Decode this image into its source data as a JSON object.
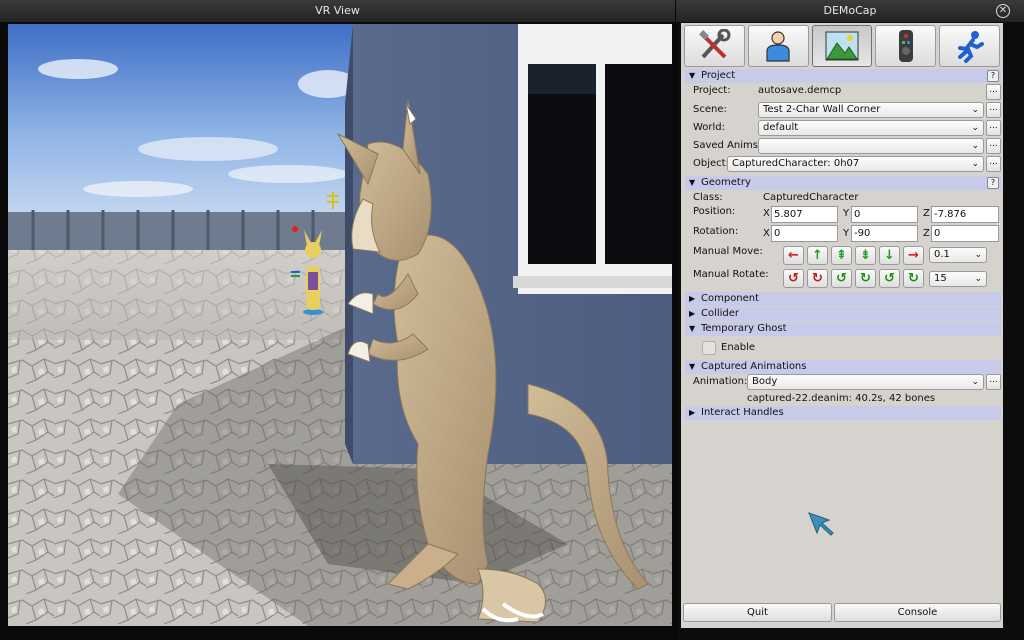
{
  "vr_window": {
    "title": "VR View"
  },
  "democap_window": {
    "title": "DEMoCap",
    "close_glyph": "✕",
    "toolbar": [
      {
        "icon": "tools-icon"
      },
      {
        "icon": "person-icon"
      },
      {
        "icon": "landscape-icon",
        "active": true
      },
      {
        "icon": "remote-control-icon"
      },
      {
        "icon": "running-man-icon"
      }
    ],
    "project_section": {
      "header": "Project",
      "help": "?",
      "project_label": "Project:",
      "project_value": "autosave.demcp",
      "scene_label": "Scene:",
      "scene_value": "Test 2-Char Wall Corner",
      "world_label": "World:",
      "world_value": "default",
      "saved_anims_label": "Saved Anims:",
      "saved_anims_value": "",
      "object_label": "Object:",
      "object_value": "CapturedCharacter: 0h07"
    },
    "geometry_section": {
      "header": "Geometry",
      "help": "?",
      "class_label": "Class:",
      "class_value": "CapturedCharacter",
      "position_label": "Position:",
      "position": {
        "x": "5.807",
        "y": "0",
        "z": "-7.876"
      },
      "rotation_label": "Rotation:",
      "rotation": {
        "x": "0",
        "y": "-90",
        "z": "0"
      },
      "axis_x": "X",
      "axis_y": "Y",
      "axis_z": "Z",
      "manual_move_label": "Manual Move:",
      "manual_move_step": "0.1",
      "manual_rotate_label": "Manual Rotate:",
      "manual_rotate_step": "15"
    },
    "collapsed_sections": {
      "component": "Component",
      "collider": "Collider"
    },
    "temporary_ghost": {
      "header": "Temporary Ghost",
      "enable_label": "Enable",
      "enabled": false
    },
    "captured_animations": {
      "header": "Captured Animations",
      "animation_label": "Animation:",
      "animation_value": "Body",
      "info": "captured-22.deanim: 40.2s, 42 bones"
    },
    "interact_handles": {
      "header": "Interact Handles"
    },
    "buttons": {
      "quit": "Quit",
      "console": "Console"
    },
    "dots": "...",
    "colors": {
      "section_header": "#c7cbe9",
      "panel_bg": "#d6d2ce",
      "arrow_red": "#d42020",
      "arrow_green": "#1ea01e",
      "rotate_red": "#c01818",
      "rotate_green": "#189018"
    }
  }
}
